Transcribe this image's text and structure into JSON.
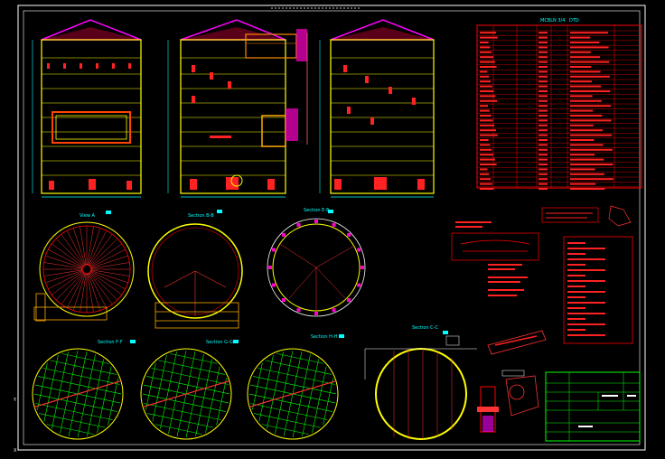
{
  "colors": {
    "background": "#000000",
    "frame": "#ffffff",
    "shell": "#ffff00",
    "structure": "#ff0000",
    "rafter": "#ff3333",
    "dimension": "#00ffff",
    "grid": "#00ff00",
    "roof": "#ff00ff"
  },
  "drawing": {
    "type": "storage tank general arrangement",
    "elevations": 3,
    "plan_sections": 7
  },
  "schedule": {
    "title": "MCBLN 3/4",
    "suffix": "DTD"
  },
  "section_labels": [
    {
      "text": "View A",
      "sub": ""
    },
    {
      "text": "Section B-B",
      "sub": ""
    },
    {
      "text": "Section E-E",
      "sub": ""
    },
    {
      "text": "Section F-F",
      "sub": ""
    },
    {
      "text": "Section G-G",
      "sub": ""
    },
    {
      "text": "Section H-H",
      "sub": ""
    },
    {
      "text": "Section C-C",
      "sub": ""
    }
  ]
}
